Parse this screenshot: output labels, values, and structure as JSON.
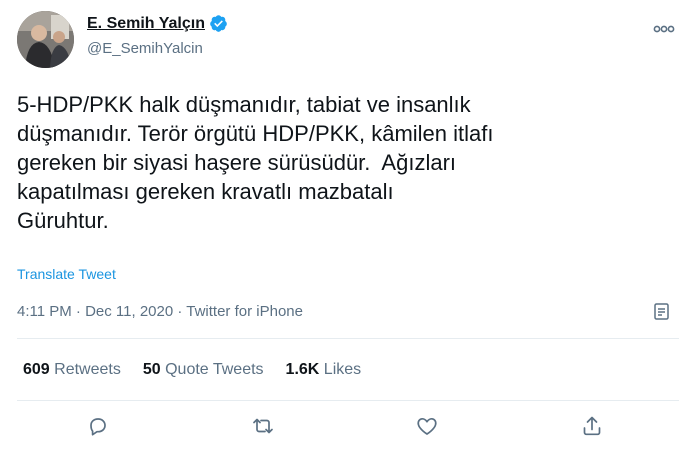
{
  "author": {
    "name": "E. Semih Yalçın",
    "handle": "@E_SemihYalcin",
    "verified": true
  },
  "tweet": {
    "lines": [
      "5-HDP/PKK halk düşmanıdır, tabiat ve insanlık",
      "düşmanıdır. Terör örgütü HDP/PKK, kâmilen itlafı",
      "gereken bir siyasi haşere sürüsüdür.  Ağızları",
      "kapatılması gereken kravatlı mazbatalı",
      "Güruhtur."
    ],
    "translate_label": "Translate Tweet",
    "meta": "4:11 PM · Dec 11, 2020 · Twitter for iPhone"
  },
  "stats": {
    "retweets_count": "609",
    "retweets_label": "Retweets",
    "quotes_count": "50",
    "quotes_label": "Quote Tweets",
    "likes_count": "1.6K",
    "likes_label": "Likes"
  },
  "colors": {
    "link": "#1b95e0",
    "secondary": "#5b7083",
    "verified": "#1da1f2"
  },
  "icons": [
    "more-icon",
    "verified-icon",
    "analytics-icon",
    "reply-icon",
    "retweet-icon",
    "like-icon",
    "share-icon"
  ]
}
